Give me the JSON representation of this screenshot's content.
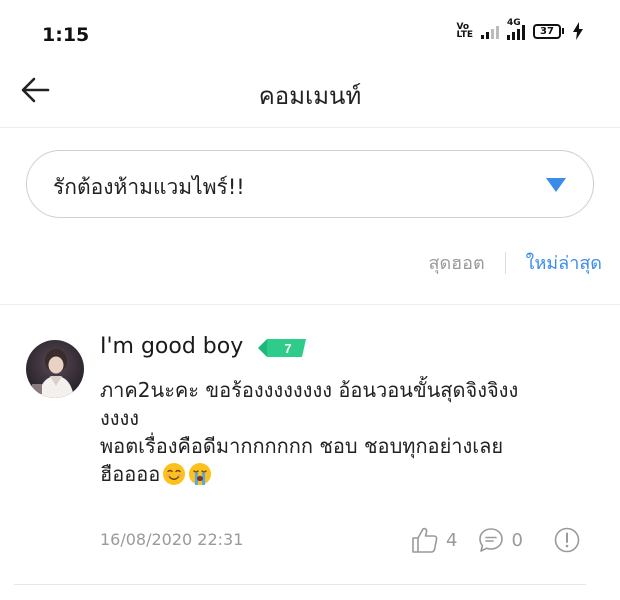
{
  "status_bar": {
    "time": "1:15",
    "volte_top": "Vo",
    "volte_bottom": "LTE",
    "network": "4G",
    "battery": "37"
  },
  "header": {
    "title": "คอมเมนท์",
    "back_icon": "arrow-left-icon"
  },
  "episode_select": {
    "value": "รักต้องห้ามแวมไพร์!!",
    "arrow_icon": "triangle-down-icon",
    "arrow_color": "#3b8bea"
  },
  "sort_tabs": {
    "hot_label": "สุดฮอต",
    "new_label": "ใหม่ล่าสุด",
    "active": "new",
    "active_color": "#3b8bea"
  },
  "comment": {
    "username": "I'm good boy",
    "level": "7",
    "level_color": "#2dcc8a",
    "lines": [
      "ภาค2นะคะ ขอร้องงงงงงงง อ้อนวอนขั้นสุดจิงจิงง",
      "งงงง",
      "พอตเรื่องคือดีมากกกกกก ชอบ ชอบทุกอย่างเลย",
      "ฮืออออ"
    ],
    "emojis": [
      "smiling-face-emoji",
      "crying-face-emoji"
    ],
    "timestamp": "16/08/2020 22:31",
    "like_count": "4",
    "reply_count": "0",
    "icons": [
      "avatar",
      "thumbs-up-icon",
      "comment-bubble-icon",
      "report-icon"
    ]
  }
}
